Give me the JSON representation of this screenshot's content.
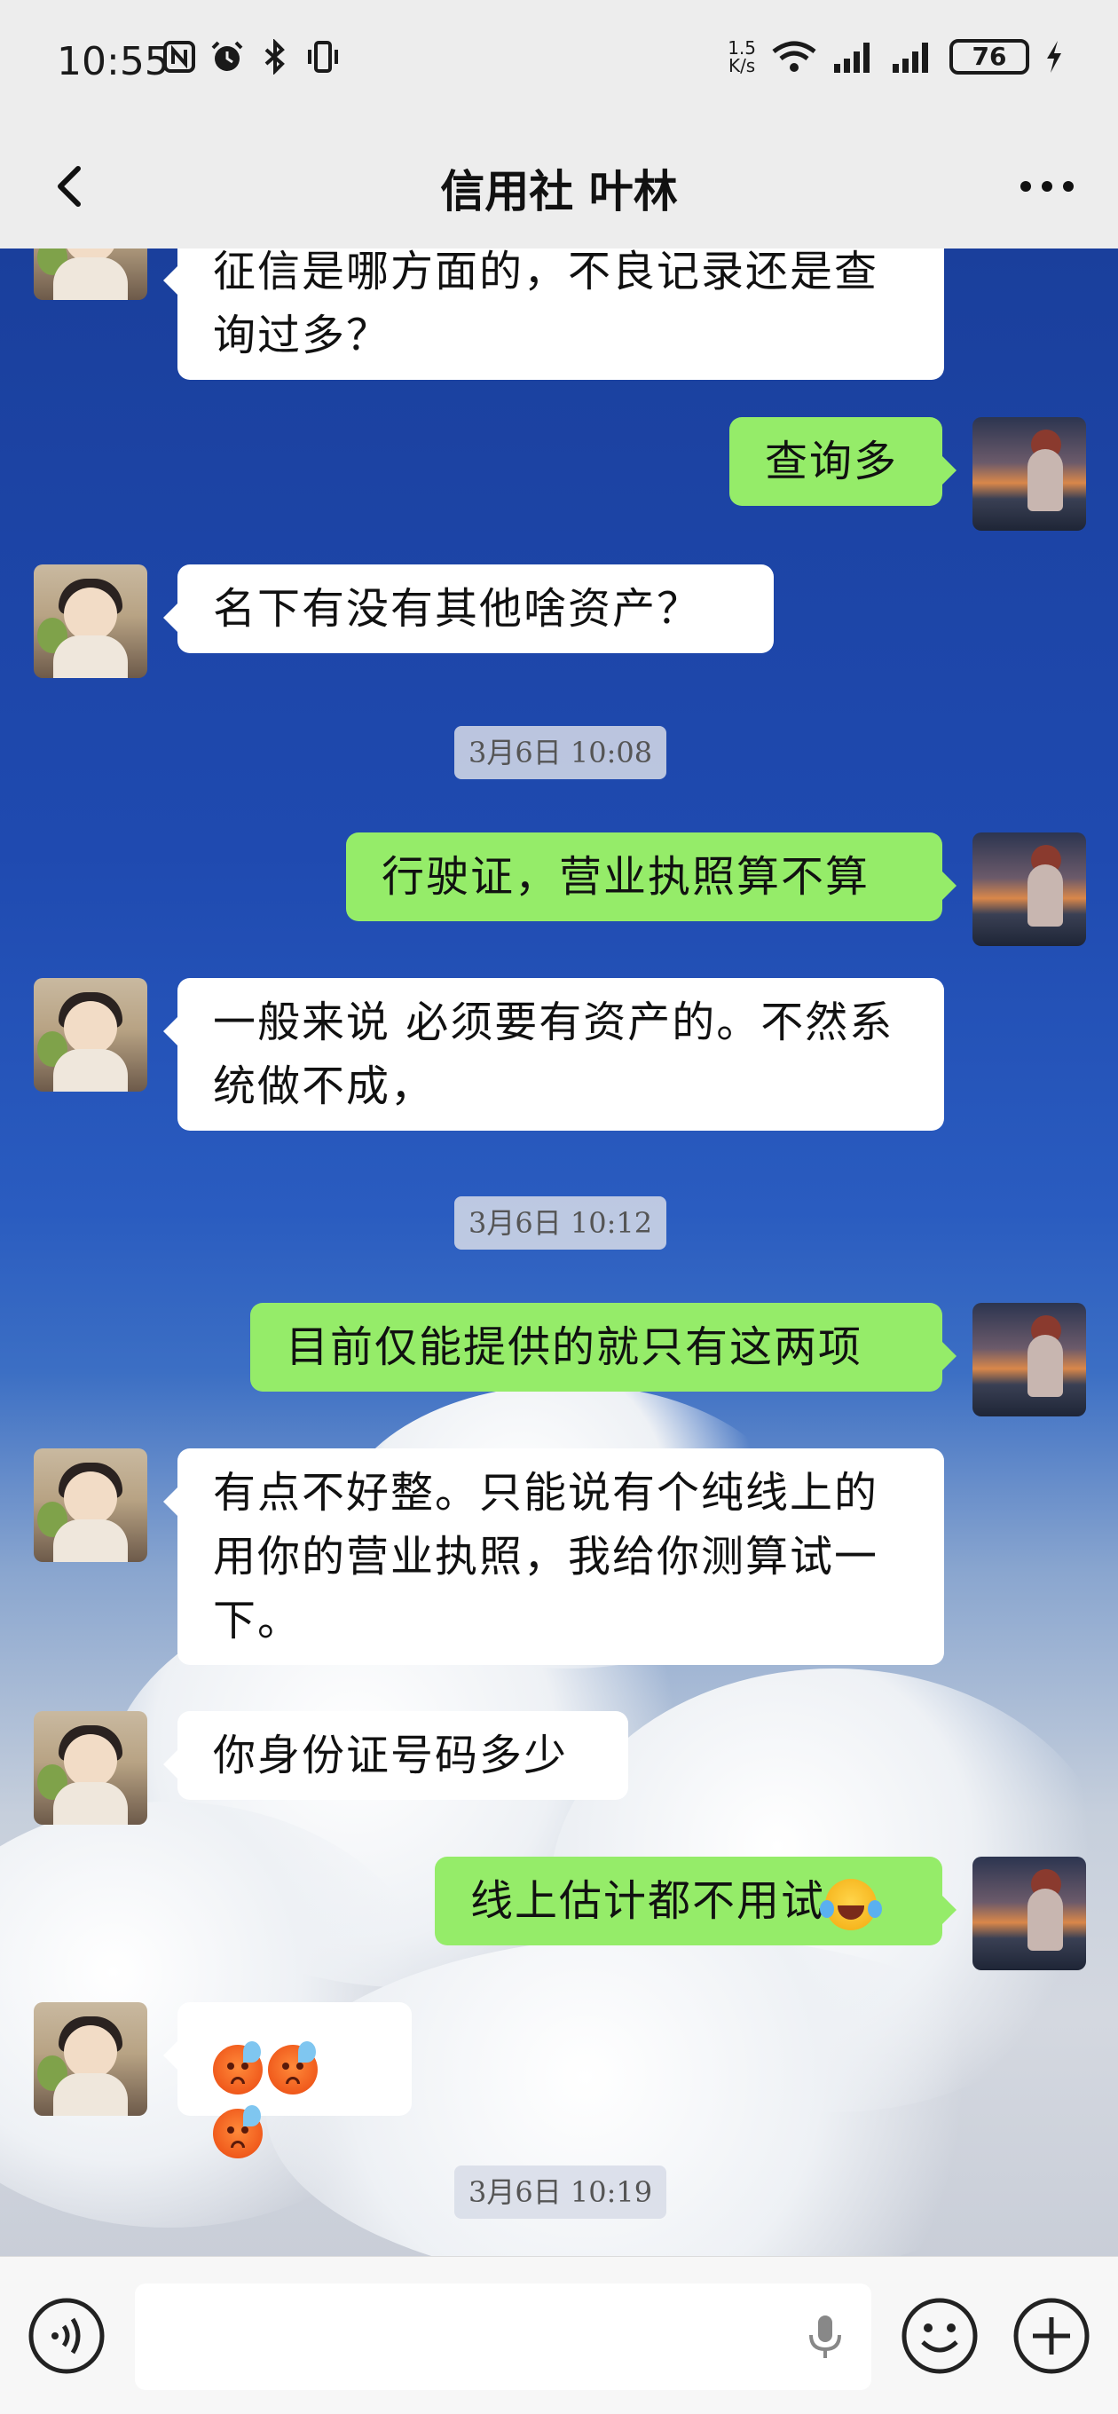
{
  "status_bar": {
    "time": "10:55",
    "net_speed_value": "1.5",
    "net_speed_unit": "K/s",
    "battery": "76",
    "icons": [
      "nfc-icon",
      "alarm-icon",
      "bluetooth-icon",
      "vibrate-icon",
      "wifi-icon",
      "signal-icon",
      "signal-icon-2",
      "charging-icon"
    ]
  },
  "header": {
    "title": "信用社 叶林"
  },
  "messages": [
    {
      "side": "left",
      "text": "征信是哪方面的，不良记录还是查询过多？"
    },
    {
      "side": "right",
      "text": "查询多"
    },
    {
      "side": "left",
      "text": " 名下有没有其他啥资产？"
    },
    {
      "type": "time",
      "text": "3月6日 10:08"
    },
    {
      "side": "right",
      "text": "行驶证，营业执照算不算"
    },
    {
      "side": "left",
      "text": "一般来说 必须要有资产的。不然系统做不成，"
    },
    {
      "type": "time",
      "text": "3月6日 10:12"
    },
    {
      "side": "right",
      "text": "目前仅能提供的就只有这两项"
    },
    {
      "side": "left",
      "text": " 有点不好整。只能说有个纯线上的用你的营业执照，我给你测算试一下。"
    },
    {
      "side": "left",
      "text": "你身份证号码多少"
    },
    {
      "side": "right",
      "text": "线上估计都不用试",
      "emoji": "laughing-crying-emoji"
    },
    {
      "side": "left",
      "text": "",
      "emoji": "sweat-frown-emoji x3"
    },
    {
      "type": "time",
      "text": "3月6日 10:19"
    }
  ]
}
